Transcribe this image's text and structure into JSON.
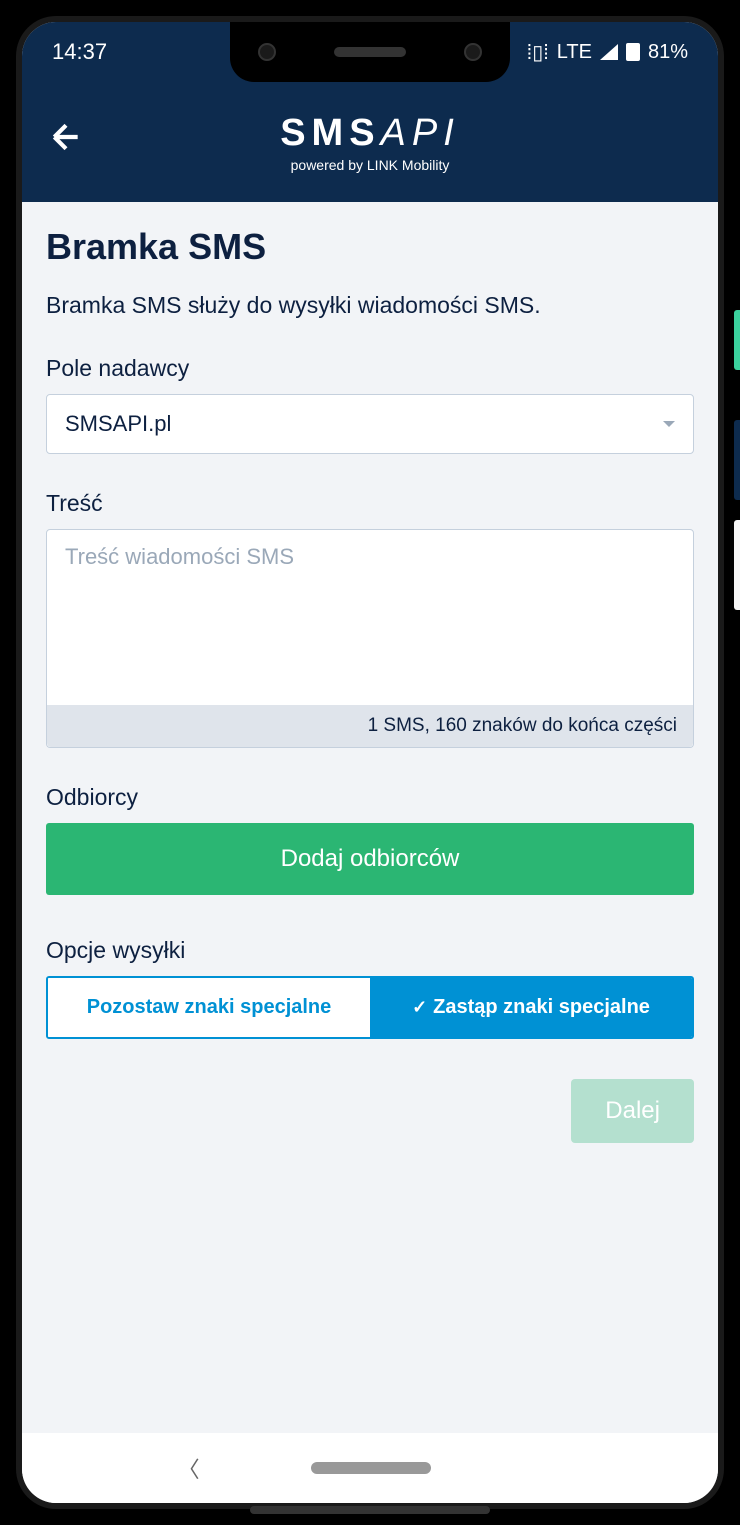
{
  "status_bar": {
    "time": "14:37",
    "network": "LTE",
    "battery": "81%"
  },
  "header": {
    "logo_main": "SMSAPI",
    "logo_sub": "powered by LINK Mobility"
  },
  "page": {
    "title": "Bramka SMS",
    "description": "Bramka SMS służy do wysyłki wiadomości SMS."
  },
  "sender": {
    "label": "Pole nadawcy",
    "selected": "SMSAPI.pl"
  },
  "message": {
    "label": "Treść",
    "placeholder": "Treść wiadomości SMS",
    "value": "",
    "counter": "1 SMS, 160 znaków do końca części"
  },
  "recipients": {
    "label": "Odbiorcy",
    "add_button": "Dodaj odbiorców"
  },
  "options": {
    "label": "Opcje wysyłki",
    "keep_special": "Pozostaw znaki specjalne",
    "replace_special": "Zastąp znaki specjalne"
  },
  "actions": {
    "next": "Dalej"
  }
}
